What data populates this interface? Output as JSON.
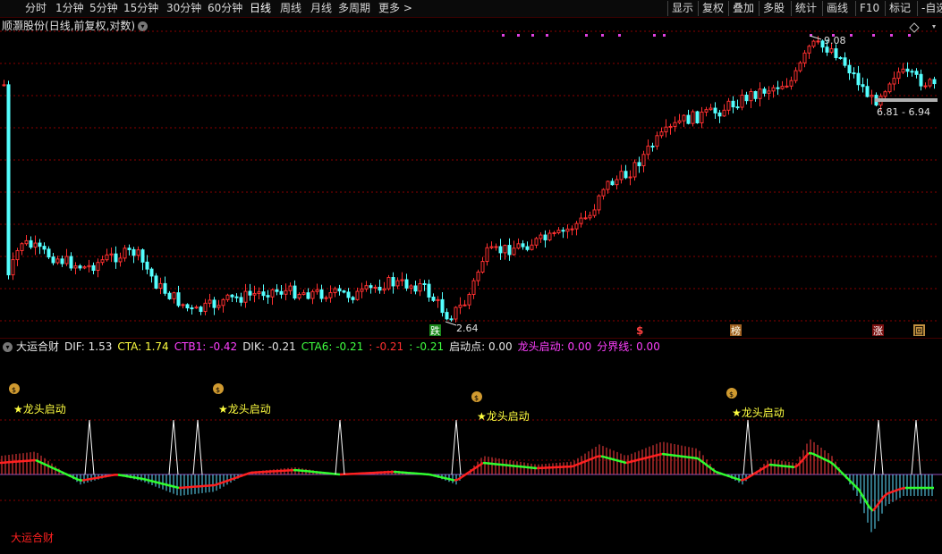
{
  "toolbar": {
    "left": [
      "分时",
      "1分钟",
      "5分钟",
      "15分钟",
      "30分钟",
      "60分钟",
      "日线",
      "周线",
      "月线",
      "多周期",
      "更多 >"
    ],
    "active": "日线",
    "right": [
      "显示",
      "复权",
      "叠加",
      "多股",
      "统计",
      "画线",
      "F10",
      "标记",
      "-自选"
    ]
  },
  "chart": {
    "stock_name": "顺灏股份",
    "mode": "(日线,前复权,对数)",
    "high_label": "9.08",
    "low_label": "2.64",
    "range_label": "6.81 - 6.94",
    "markers": {
      "die": "跌",
      "dollar": "$",
      "bang": "榜",
      "zhang": "涨",
      "hui": "回"
    }
  },
  "indicator": {
    "name": "大运合财",
    "fields": [
      {
        "label": "DIF: 1.53",
        "color": "#e8e8e8"
      },
      {
        "label": "CTA: 1.74",
        "color": "#ffff40"
      },
      {
        "label": "CTB1: -0.42",
        "color": "#ff40ff"
      },
      {
        "label": "DIK: -0.21",
        "color": "#e8e8e8"
      },
      {
        "label": "CTA6: -0.21",
        "color": "#40ff40"
      },
      {
        "label": ": -0.21",
        "color": "#ff3030"
      },
      {
        "label": ": -0.21",
        "color": "#40ff40"
      },
      {
        "label": "启动点: 0.00",
        "color": "#e8e8e8"
      },
      {
        "label": "龙头启动: 0.00",
        "color": "#ff40ff"
      },
      {
        "label": "分界线: 0.00",
        "color": "#ff40ff"
      }
    ],
    "signal_text": "★龙头启动",
    "bottom_label": "大运合财"
  },
  "colors": {
    "up": "#ff3030",
    "down": "#54ffff",
    "grid": "#8a0000",
    "signal": "#ffff40",
    "purple": "#e040e0"
  }
}
